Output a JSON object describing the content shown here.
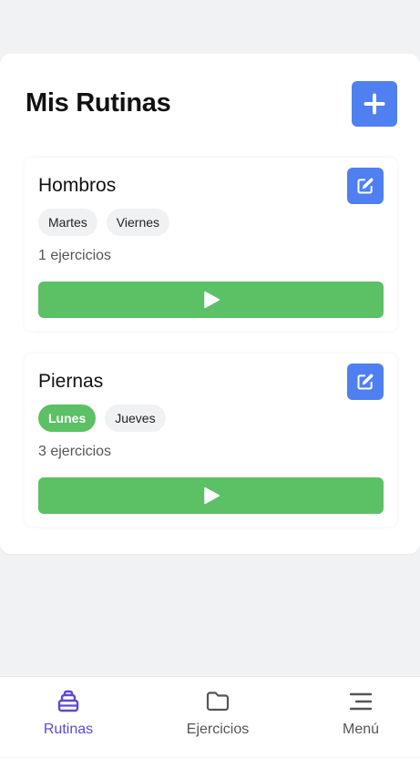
{
  "header": {
    "title": "Mis Rutinas"
  },
  "routines": [
    {
      "name": "Hombros",
      "days": [
        {
          "label": "Martes",
          "active": false
        },
        {
          "label": "Viernes",
          "active": false
        }
      ],
      "exercise_count": "1 ejercicios"
    },
    {
      "name": "Piernas",
      "days": [
        {
          "label": "Lunes",
          "active": true
        },
        {
          "label": "Jueves",
          "active": false
        }
      ],
      "exercise_count": "3 ejercicios"
    }
  ],
  "nav": {
    "items": [
      {
        "label": "Rutinas",
        "icon": "dumbbell-stack-icon",
        "active": true
      },
      {
        "label": "Ejercicios",
        "icon": "folder-icon",
        "active": false
      },
      {
        "label": "Menú",
        "icon": "menu-icon",
        "active": false
      }
    ]
  },
  "colors": {
    "primary": "#4f7ff0",
    "success": "#5cc064",
    "nav_active": "#5a49d6",
    "background": "#f1f2f4"
  }
}
